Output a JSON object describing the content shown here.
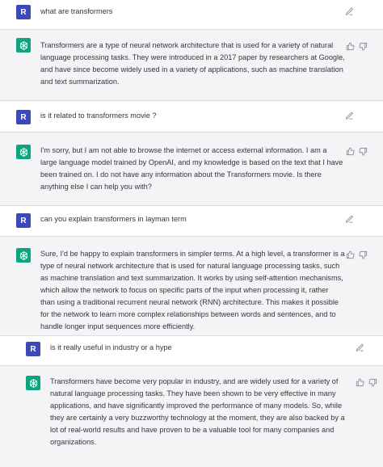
{
  "user_avatar_letter": "R",
  "icons": {
    "edit": "pencil-edit-icon",
    "assistant_avatar": "openai-logo-icon",
    "thumbs_up": "thumbs-up-icon",
    "thumbs_down": "thumbs-down-icon"
  },
  "colors": {
    "user_avatar": "#3b4ab8",
    "assistant_avatar": "#10a37f",
    "assistant_bg": "#f4f4f6"
  },
  "conversation": [
    {
      "role": "user",
      "text": "what are transformers"
    },
    {
      "role": "assistant",
      "text": "Transformers are a type of neural network architecture that is used for a variety of natural\nlanguage processing tasks. They were introduced in a 2017 paper by researchers at Google,\nand have since become widely used in a variety of applications, such as machine translation\nand text summarization."
    },
    {
      "role": "user",
      "text": "is it related to transformers movie ?"
    },
    {
      "role": "assistant",
      "text": "I'm sorry, but I am not able to browse the internet or access external information. I am a\nlarge language model trained by OpenAI, and my knowledge is based on the text that I have\nbeen trained on. I do not have any information about the Transformers movie. Is there\nanything else I can help you with?"
    },
    {
      "role": "user",
      "text": "can you explain transformers in layman term"
    },
    {
      "role": "assistant",
      "text": "Sure, I'd be happy to explain transformers in simpler terms. At a high level, a transformer is a\ntype of neural network architecture that is used for natural language processing tasks, such\nas machine translation and text summarization. It works by using self-attention mechanisms,\nwhich allow the network to focus on specific parts of the input when processing it, rather\nthan using a traditional recurrent neural network (RNN) architecture. This makes it possible\nfor the network to learn more complex relationships between words and sentences, and to\nhandle longer input sequences more efficiently."
    },
    {
      "role": "user",
      "text": "is it really useful in industry or a hype"
    },
    {
      "role": "assistant",
      "text": "Transformers have become very popular in industry, and are widely used for a variety of\nnatural language processing tasks. They have been shown to be very effective in many\napplications, and have significantly improved the performance of many models. So, while\nthey are certainly a very buzzworthy technology at the moment, they are also backed by a\nlot of real-world results and have proven to be a valuable tool for many companies and\norganizations."
    }
  ]
}
